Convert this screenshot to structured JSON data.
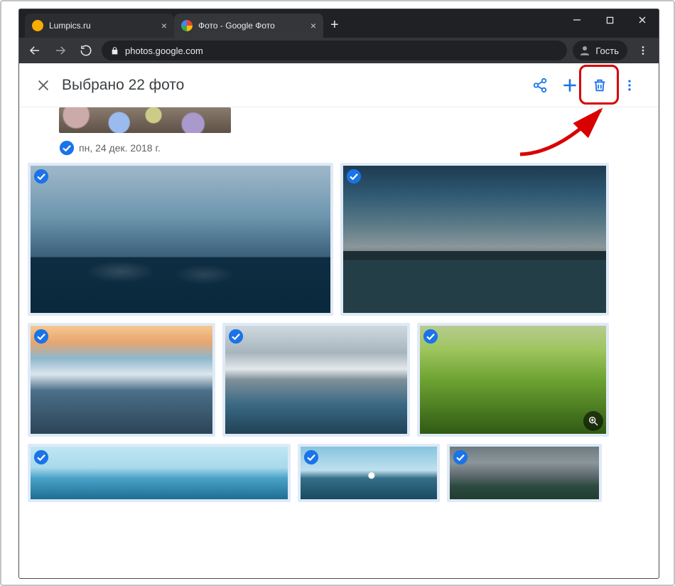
{
  "titlebar": {
    "tabs": [
      {
        "title": "Lumpics.ru"
      },
      {
        "title": "Фото - Google Фото"
      }
    ]
  },
  "addressbar": {
    "url": "photos.google.com",
    "guest_label": "Гость"
  },
  "selection_bar": {
    "title": "Выбрано 22 фото"
  },
  "gallery": {
    "date_label": "пн, 24 дек. 2018 г."
  }
}
